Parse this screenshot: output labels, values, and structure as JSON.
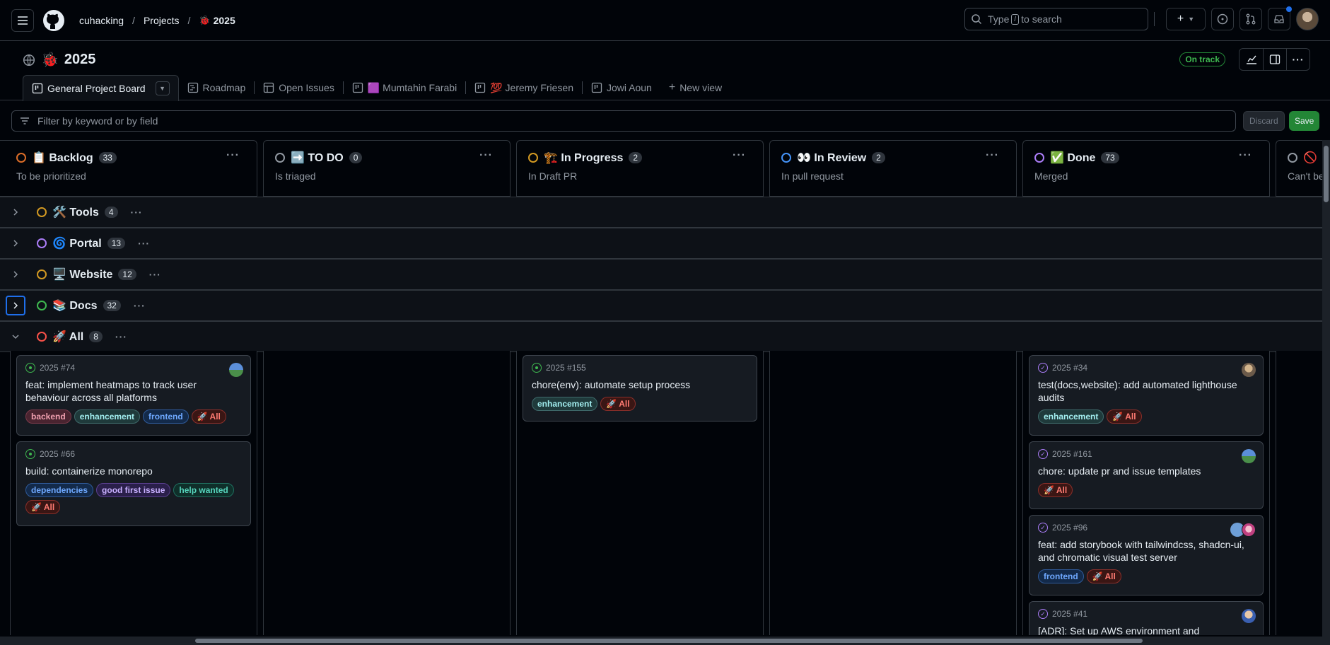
{
  "topbar": {
    "org": "cuhacking",
    "projects": "Projects",
    "project_emoji": "🐞",
    "project": "2025",
    "search_pre": "Type",
    "search_key": "/",
    "search_post": "to search"
  },
  "project": {
    "title": "2025",
    "emoji": "🐞",
    "status": "On track"
  },
  "views": [
    {
      "label": "General Project Board"
    },
    {
      "label": "Roadmap"
    },
    {
      "label": "Open Issues"
    },
    {
      "label": "🟪 Mumtahin Farabi"
    },
    {
      "label": "💯 Jeremy Friesen"
    },
    {
      "label": "Jowi Aoun"
    },
    {
      "label": "New view"
    }
  ],
  "filter": {
    "placeholder": "Filter by keyword or by field",
    "discard": "Discard",
    "save": "Save"
  },
  "columns": [
    {
      "name": "📋 Backlog",
      "count": "33",
      "desc": "To be prioritized",
      "color": "#db6d28"
    },
    {
      "name": "➡️ TO DO",
      "count": "0",
      "desc": "Is triaged",
      "color": "#9198a1"
    },
    {
      "name": "🏗️ In Progress",
      "count": "2",
      "desc": "In Draft PR",
      "color": "#d29922"
    },
    {
      "name": "👀 In Review",
      "count": "2",
      "desc": "In pull request",
      "color": "#4493f8"
    },
    {
      "name": "✅ Done",
      "count": "73",
      "desc": "Merged",
      "color": "#ab7df8"
    },
    {
      "name": "🚫",
      "count": "",
      "desc": "Can't be",
      "color": "#9198a1"
    }
  ],
  "groups": [
    {
      "name": "🛠️ Tools",
      "count": "4",
      "color": "#d29922"
    },
    {
      "name": "🌀 Portal",
      "count": "13",
      "color": "#ab7df8"
    },
    {
      "name": "🖥️ Website",
      "count": "12",
      "color": "#d29922"
    },
    {
      "name": "📚 Docs",
      "count": "32",
      "color": "#3fb950"
    },
    {
      "name": "🚀 All",
      "count": "8",
      "color": "#f85149"
    }
  ],
  "cards": {
    "backlog": [
      {
        "ref": "2025 #74",
        "title": "feat: implement heatmaps to track user behaviour across all platforms",
        "labels": [
          "backend",
          "enhancement",
          "frontend",
          "🚀 All"
        ]
      },
      {
        "ref": "2025 #66",
        "title": "build: containerize monorepo",
        "labels": [
          "dependencies",
          "good first issue",
          "help wanted",
          "🚀 All"
        ]
      }
    ],
    "progress": [
      {
        "ref": "2025 #155",
        "title": "chore(env): automate setup process",
        "labels": [
          "enhancement",
          "🚀 All"
        ]
      }
    ],
    "done": [
      {
        "ref": "2025 #34",
        "title": "test(docs,website): add automated lighthouse audits",
        "labels": [
          "enhancement",
          "🚀 All"
        ]
      },
      {
        "ref": "2025 #161",
        "title": "chore: update pr and issue templates",
        "labels": [
          "🚀 All"
        ]
      },
      {
        "ref": "2025 #96",
        "title": "feat: add storybook with tailwindcss, shadcn-ui, and chromatic visual test server",
        "labels": [
          "frontend",
          "🚀 All"
        ]
      },
      {
        "ref": "2025 #41",
        "title": "[ADR]: Set up AWS environment and",
        "labels": []
      }
    ]
  },
  "label_colors": {
    "backend": "#e5534b",
    "enhancement": "#a2eeef",
    "frontend": "#4493f8",
    "🚀 All": "#f85149",
    "dependencies": "#4493f8",
    "good first issue": "#a371f7",
    "help wanted": "#2ea043"
  }
}
